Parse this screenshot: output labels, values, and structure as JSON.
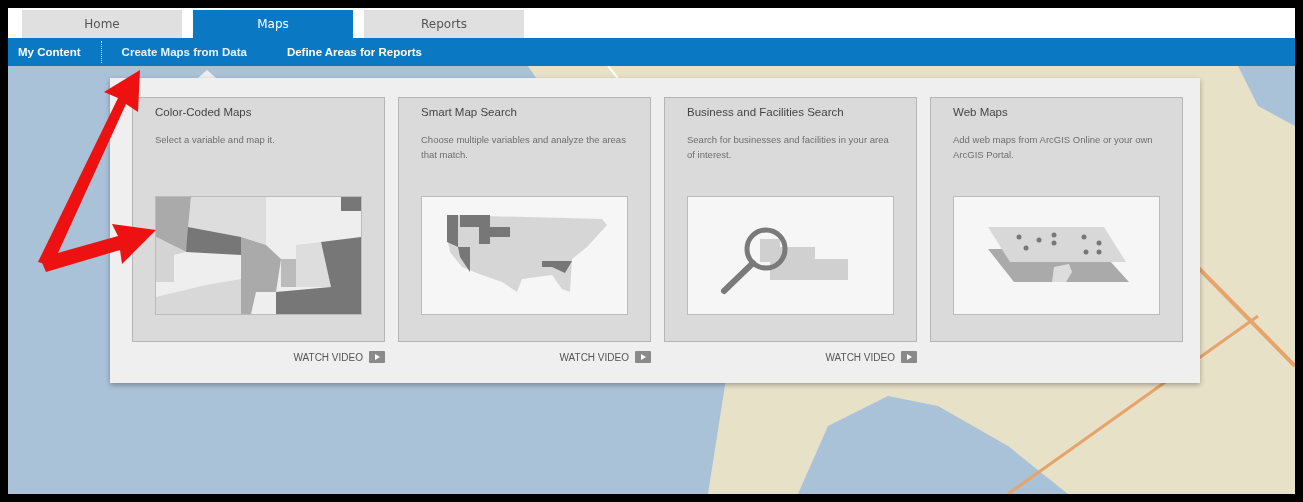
{
  "tabs": [
    {
      "label": "Home",
      "selected": false
    },
    {
      "label": "Maps",
      "selected": true
    },
    {
      "label": "Reports",
      "selected": false
    }
  ],
  "nav": [
    {
      "label": "My Content",
      "selected": false
    },
    {
      "label": "Create Maps from Data",
      "selected": true
    },
    {
      "label": "Define Areas for Reports",
      "selected": false
    }
  ],
  "cards": [
    {
      "title": "Color-Coded Maps",
      "description": "Select a variable and map it.",
      "kind": "choropleth",
      "watch_video": "WATCH VIDEO"
    },
    {
      "title": "Smart Map Search",
      "description": "Choose multiple variables and analyze the areas that match.",
      "kind": "us-map",
      "watch_video": "WATCH VIDEO"
    },
    {
      "title": "Business and Facilities Search",
      "description": "Search for businesses and facilities in your area of interest.",
      "kind": "search",
      "watch_video": "WATCH VIDEO"
    },
    {
      "title": "Web Maps",
      "description": "Add web maps from ArcGIS Online or your own ArcGIS Portal.",
      "kind": "layers"
    }
  ]
}
